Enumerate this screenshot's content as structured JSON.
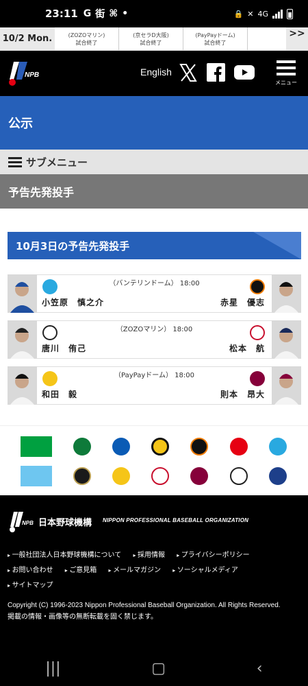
{
  "status_bar": {
    "time": "23:11",
    "left_icons": [
      "G",
      "街",
      "⌘",
      "•"
    ],
    "network": "4G"
  },
  "ticker": {
    "date": "10/2 Mon.",
    "games": [
      {
        "venue": "(ZOZOマリン)",
        "status": "試合終了"
      },
      {
        "venue": "(京セラD大阪)",
        "status": "試合終了"
      },
      {
        "venue": "(PayPayドーム)",
        "status": "試合終了"
      }
    ],
    "next": ">>"
  },
  "header": {
    "english": "English",
    "menu_label": "メニュー"
  },
  "title": "公示",
  "submenu": "サブメニュー",
  "page_heading": "予告先発投手",
  "section_title": "10月3日の予告先発投手",
  "games": [
    {
      "venue": "（バンテリンドーム） 18:00",
      "home_pitcher": "小笠原　慎之介",
      "away_pitcher": "赤星　優志",
      "home_color": "#1f4fa0",
      "away_color": "#f07b00"
    },
    {
      "venue": "（ZOZOマリン） 18:00",
      "home_pitcher": "唐川　侑己",
      "away_pitcher": "松本　航",
      "home_color": "#222222",
      "away_color": "#c8102e"
    },
    {
      "venue": "（PayPayドーム） 18:00",
      "home_pitcher": "和田　毅",
      "away_pitcher": "則本　昂大",
      "home_color": "#f5c518",
      "away_color": "#86003a"
    }
  ],
  "footer": {
    "org_jp": "日本野球機構",
    "org_en": "NIPPON PROFESSIONAL BASEBALL ORGANIZATION",
    "links_row1": [
      "一般社団法人日本野球機構について",
      "採用情報",
      "プライバシーポリシー"
    ],
    "links_row2": [
      "お問い合わせ",
      "ご意見箱",
      "メールマガジン",
      "ソーシャルメディア"
    ],
    "links_row3": [
      "サイトマップ"
    ],
    "copyright": "Copyright (C) 1996-2023 Nippon Professional Baseball Organization. All Rights Reserved.",
    "notice": "掲載の情報・画像等の無断転載を固く禁じます。"
  },
  "colors": {
    "primary": "#2660b9",
    "header": "#000000",
    "gray": "#777777"
  }
}
